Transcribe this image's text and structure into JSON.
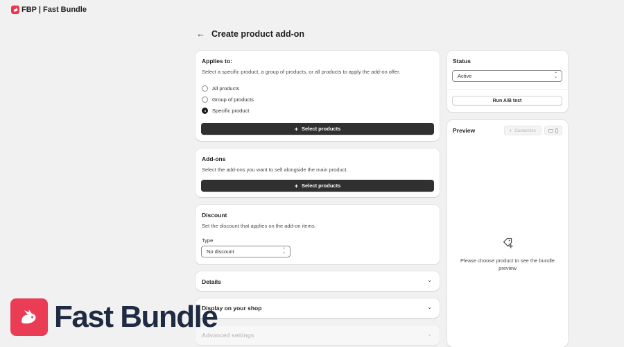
{
  "app": {
    "title": "FBP | Fast Bundle"
  },
  "page": {
    "title": "Create product add-on",
    "back_icon": "arrow-left-icon"
  },
  "applies_to": {
    "title": "Applies to:",
    "description": "Select a specific product, a group of products, or all products to apply the add-on offer.",
    "options": [
      {
        "label": "All products",
        "checked": false
      },
      {
        "label": "Group of products",
        "checked": false
      },
      {
        "label": "Specific product",
        "checked": true
      }
    ],
    "button_label": "Select products"
  },
  "addons": {
    "title": "Add-ons",
    "description": "Select the add-ons you want to sell alongside the main product.",
    "button_label": "Select products"
  },
  "discount": {
    "title": "Discount",
    "description": "Set the discount that applies on the add-on items.",
    "type_label": "Type",
    "type_value": "No discount"
  },
  "details": {
    "title": "Details"
  },
  "display": {
    "title": "Display on your shop"
  },
  "advanced": {
    "title": "Advanced settings"
  },
  "status": {
    "title": "Status",
    "value": "Active",
    "ab_button": "Run A/B test"
  },
  "preview": {
    "title": "Preview",
    "customize_label": "Customize",
    "empty_text": "Please choose product to see the bundle preview"
  },
  "brand": {
    "name": "Fast Bundle"
  },
  "colors": {
    "accent": "#ea3d55",
    "primary_button": "#303030",
    "brand_text": "#1f2b42"
  }
}
